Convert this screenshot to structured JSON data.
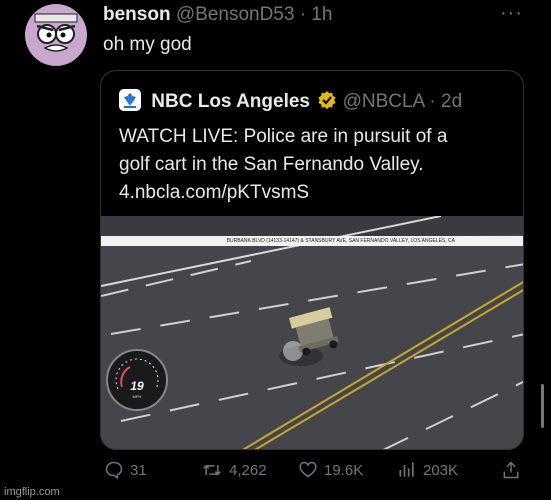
{
  "tweet": {
    "author_name": "benson",
    "author_handle": "@BensonD53 · 1h",
    "text": "oh my god",
    "more_label": "···"
  },
  "quote": {
    "name": "NBC Los Angeles",
    "handle": "@NBCLA · 2d",
    "text_line1": "WATCH LIVE: Police are in pursuit of a",
    "text_line2": "golf cart in the San Fernando Valley.",
    "link": "4.nbcla.com/pKTvsmS",
    "media_caption": "BURBANK BLVD (14133-14147) & STANSBURY AVE, SAN FERNANDO VALLEY, LOS ANGELES, CA",
    "speed_value": "19",
    "speed_unit": "MPH"
  },
  "actions": {
    "replies": "31",
    "retweets": "4,262",
    "likes": "19.6K",
    "views": "203K"
  },
  "watermark": "imgflip.com",
  "colors": {
    "background": "#000000",
    "text": "#e7e9ea",
    "muted": "#71767b",
    "verified_gold": "#e2b719",
    "avatar": "#c9a7cf"
  },
  "icons": [
    "reply-icon",
    "retweet-icon",
    "like-icon",
    "views-icon",
    "share-icon",
    "verified-badge-icon",
    "nbc-peacock-icon"
  ]
}
